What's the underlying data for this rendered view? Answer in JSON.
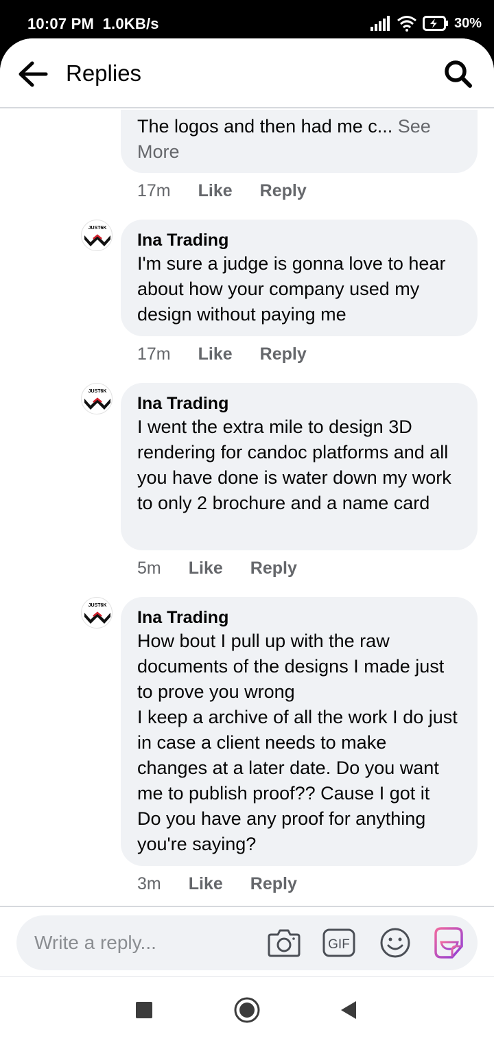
{
  "status_bar": {
    "time": "10:07 PM",
    "net_speed": "1.0KB/s",
    "battery": "30%"
  },
  "header": {
    "title": "Replies",
    "back_icon": "back-arrow-icon",
    "search_icon": "search-icon"
  },
  "comments": [
    {
      "author": "",
      "text": "The logos and then had me c...",
      "see_more": " See More",
      "time": "17m",
      "like": "Like",
      "reply": "Reply"
    },
    {
      "author": "Ina Trading",
      "avatar_label": "JUST6K",
      "text": "I'm sure a judge is gonna love to hear about how your company used my design without paying me",
      "time": "17m",
      "like": "Like",
      "reply": "Reply"
    },
    {
      "author": "Ina Trading",
      "avatar_label": "JUST6K",
      "text": "I went the extra mile to design 3D rendering for candoc platforms and all you have done is water down my work to only 2 brochure and a name card",
      "time": "5m",
      "like": "Like",
      "reply": "Reply"
    },
    {
      "author": "Ina Trading",
      "avatar_label": "JUST6K",
      "text": "How bout I pull up with the raw documents of the designs I made just to prove you wrong\nI keep a archive of all the work I do just in case a client needs to make changes at a later date. Do you want me to publish proof?? Cause I got it\nDo you have any proof for anything you're saying?",
      "time": "3m",
      "like": "Like",
      "reply": "Reply"
    }
  ],
  "composer": {
    "placeholder": "Write a reply...",
    "gif_label": "GIF",
    "icons": [
      "camera-icon",
      "gif-icon",
      "emoji-icon",
      "sticker-icon"
    ]
  },
  "colors": {
    "bubble": "#f0f2f5",
    "secondary_text": "#65676b",
    "sticker_accent": "#a040d0"
  }
}
